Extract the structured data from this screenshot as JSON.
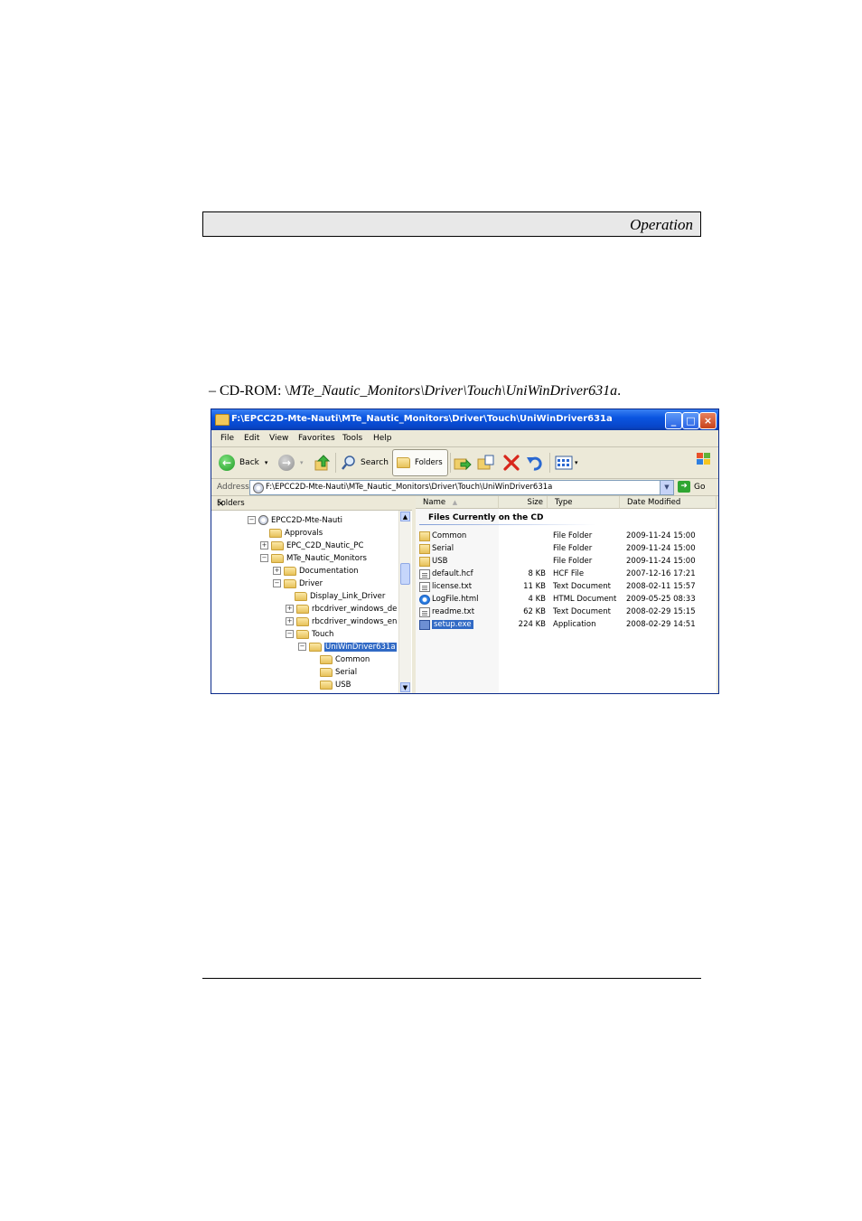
{
  "page": {
    "header_label": "Operation",
    "path_prefix": "– CD-ROM: \\",
    "path_italic": "MTe_Nautic_Monitors\\Driver\\Touch\\UniWinDriver631a",
    "path_suffix": "."
  },
  "window": {
    "title": "F:\\EPCC2D-Mte-Nauti\\MTe_Nautic_Monitors\\Driver\\Touch\\UniWinDriver631a",
    "menu": [
      "File",
      "Edit",
      "View",
      "Favorites",
      "Tools",
      "Help"
    ],
    "toolbar": {
      "back": "Back",
      "search": "Search",
      "folders": "Folders"
    },
    "address_label": "Address",
    "address_value": "F:\\EPCC2D-Mte-Nauti\\MTe_Nautic_Monitors\\Driver\\Touch\\UniWinDriver631a",
    "go_label": "Go",
    "folders_pane_title": "Folders",
    "folders_close": "×",
    "tree": [
      {
        "label": "EPCC2D-Mte-Nauti",
        "level": 0,
        "exp": "−",
        "icon": "cd"
      },
      {
        "label": "Approvals",
        "level": 1,
        "exp": ""
      },
      {
        "label": "EPC_C2D_Nautic_PC",
        "level": 1,
        "exp": "+"
      },
      {
        "label": "MTe_Nautic_Monitors",
        "level": 1,
        "exp": "−"
      },
      {
        "label": "Documentation",
        "level": 2,
        "exp": "+"
      },
      {
        "label": "Driver",
        "level": 2,
        "exp": "−"
      },
      {
        "label": "Display_Link_Driver",
        "level": 3,
        "exp": ""
      },
      {
        "label": "rbcdriver_windows_de",
        "level": 3,
        "exp": "+"
      },
      {
        "label": "rbcdriver_windows_en",
        "level": 3,
        "exp": "+"
      },
      {
        "label": "Touch",
        "level": 3,
        "exp": "−"
      },
      {
        "label": "UniWinDriver631a",
        "level": 4,
        "exp": "−",
        "selected": true
      },
      {
        "label": "Common",
        "level": 5,
        "exp": ""
      },
      {
        "label": "Serial",
        "level": 5,
        "exp": ""
      },
      {
        "label": "USB",
        "level": 5,
        "exp": ""
      }
    ],
    "columns": {
      "name": "Name",
      "size": "Size",
      "type": "Type",
      "date": "Date Modified"
    },
    "group_title": "Files Currently on the CD",
    "files": [
      {
        "name": "Common",
        "size": "",
        "type": "File Folder",
        "date": "2009-11-24 15:00",
        "icon": "folder"
      },
      {
        "name": "Serial",
        "size": "",
        "type": "File Folder",
        "date": "2009-11-24 15:00",
        "icon": "folder"
      },
      {
        "name": "USB",
        "size": "",
        "type": "File Folder",
        "date": "2009-11-24 15:00",
        "icon": "folder"
      },
      {
        "name": "default.hcf",
        "size": "8 KB",
        "type": "HCF File",
        "date": "2007-12-16 17:21",
        "icon": "doc"
      },
      {
        "name": "license.txt",
        "size": "11 KB",
        "type": "Text Document",
        "date": "2008-02-11 15:57",
        "icon": "doc"
      },
      {
        "name": "LogFile.html",
        "size": "4 KB",
        "type": "HTML Document",
        "date": "2009-05-25 08:33",
        "icon": "ie"
      },
      {
        "name": "readme.txt",
        "size": "62 KB",
        "type": "Text Document",
        "date": "2008-02-29 15:15",
        "icon": "doc"
      },
      {
        "name": "setup.exe",
        "size": "224 KB",
        "type": "Application",
        "date": "2008-02-29 14:51",
        "icon": "exe",
        "selected": true
      }
    ]
  }
}
